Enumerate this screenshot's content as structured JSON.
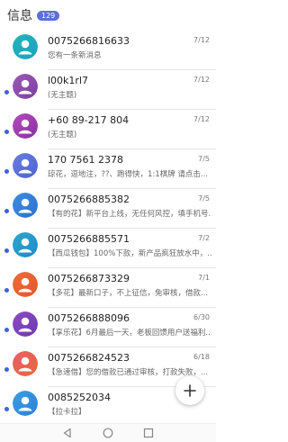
{
  "header": {
    "title": "信息",
    "badge": "129"
  },
  "colors": {
    "badge": "#5b6fd6",
    "unread_dot": "#3e63d3"
  },
  "conversations": [
    {
      "name": "0075266816633",
      "date": "7/12",
      "preview": "您有一条新消息",
      "unread": false,
      "avatar_color": "#23b6b4",
      "avatar_color2": "#1b9fc7"
    },
    {
      "name": "l00k1rl7",
      "date": "7/12",
      "preview": "(无主题)",
      "unread": true,
      "avatar_color": "#9b59b6",
      "avatar_color2": "#7e3fa3"
    },
    {
      "name": "+60 89-217 804",
      "date": "7/12",
      "preview": "(无主题)",
      "unread": true,
      "avatar_color": "#b34ac0",
      "avatar_color2": "#8a2fa0"
    },
    {
      "name": "170 7561 2378",
      "date": "7/5",
      "preview": "琼花，逗地注，??、跑得快，1:1棋牌 请点击...",
      "unread": true,
      "avatar_color": "#6a7de0",
      "avatar_color2": "#4c63d2"
    },
    {
      "name": "0075266885382",
      "date": "7/5",
      "preview": "【有的花】新平台上线，无任何风控，填手机号...",
      "unread": true,
      "avatar_color": "#3b8fe0",
      "avatar_color2": "#2f6fd0"
    },
    {
      "name": "0075266885571",
      "date": "7/2",
      "preview": "【西瓜钱包】100%下款，新产品疯狂放水中，...",
      "unread": true,
      "avatar_color": "#2aa8c9",
      "avatar_color2": "#2389c9"
    },
    {
      "name": "0075266873329",
      "date": "7/1",
      "preview": "【多花】最新口子，不上征信，免审核，借款...",
      "unread": true,
      "avatar_color": "#f06a3c",
      "avatar_color2": "#e05a2a"
    },
    {
      "name": "0075266888096",
      "date": "6/30",
      "preview": "【享乐花】6月最后一天，老板回馈用户送福利...",
      "unread": true,
      "avatar_color": "#8e4cc2",
      "avatar_color2": "#6b38b0"
    },
    {
      "name": "0075266824523",
      "date": "6/18",
      "preview": "【急速借】您的借款已通过审核，打款失败，...",
      "unread": true,
      "avatar_color": "#ee5b6a",
      "avatar_color2": "#e36a3a"
    },
    {
      "name": "0085252034",
      "date": "",
      "preview": "【拉卡拉】",
      "unread": true,
      "avatar_color": "#3aa0e0",
      "avatar_color2": "#2b7fd8"
    }
  ],
  "fab": {
    "icon": "plus-icon"
  },
  "navbar": {
    "icons": [
      "back-icon",
      "home-icon",
      "recents-icon"
    ]
  }
}
